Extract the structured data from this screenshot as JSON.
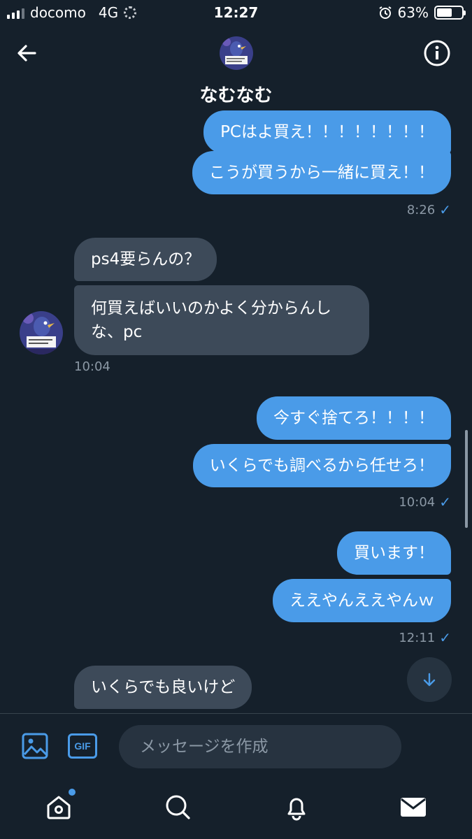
{
  "status_bar": {
    "carrier": "docomo",
    "network": "4G",
    "time": "12:27",
    "battery": "63%",
    "battery_level": 0.63
  },
  "header": {
    "name": "なむなむ"
  },
  "messages": [
    {
      "dir": "out",
      "text": "PCはよ買え！！！！！！！！"
    },
    {
      "dir": "out",
      "text": "こうが買うから一緒に買え！！"
    },
    {
      "stamp": "8:26"
    },
    {
      "dir": "in",
      "text": "ps4要らんの？"
    },
    {
      "dir": "in",
      "text": "何買えばいいのかよく分からんし",
      "text2": "な、pc"
    },
    {
      "stamp": "10:04"
    },
    {
      "dir": "out",
      "text": "今すぐ捨てろ！！！！"
    },
    {
      "dir": "out",
      "text": "いくらでも調べるから任せろ！"
    },
    {
      "stamp": "10:04"
    },
    {
      "dir": "out",
      "text": "買います！"
    },
    {
      "dir": "out",
      "text": "ええやんええやんｗ"
    },
    {
      "stamp": "12:11"
    },
    {
      "dir": "in",
      "text": "いくらでも良いけど"
    }
  ],
  "composer": {
    "placeholder": "メッセージを作成",
    "gif_label": "GIF"
  },
  "colors": {
    "background": "#15202b",
    "outgoing_bubble": "#4a9be8",
    "incoming_bubble": "#3d4a59",
    "accent": "#4a9be8"
  },
  "icons": [
    "back-arrow-icon",
    "info-icon",
    "image-icon",
    "gif-icon",
    "voice-icon",
    "home-icon",
    "search-icon",
    "bell-icon",
    "mail-icon",
    "chevron-down-icon"
  ]
}
